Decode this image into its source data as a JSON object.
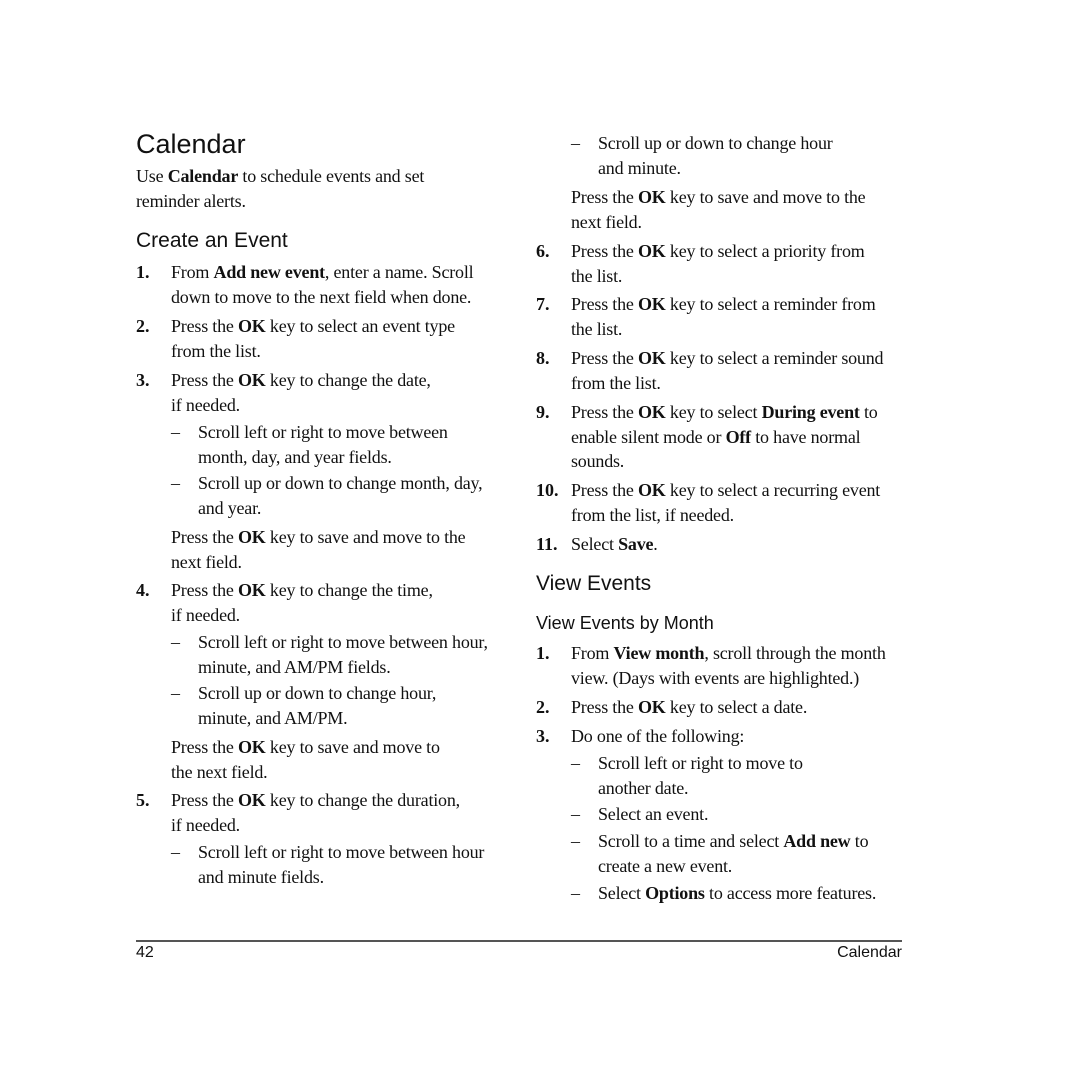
{
  "page": {
    "title": "Calendar",
    "intro_pre": "Use ",
    "intro_bold": "Calendar",
    "intro_post1": " to schedule events and set",
    "intro_post2": "reminder alerts."
  },
  "create_event": {
    "heading": "Create an Event",
    "steps": [
      {
        "num": "1.",
        "l1_pre": "From ",
        "l1_bold": "Add new event",
        "l1_post": ", enter a name. Scroll",
        "l2": "down to move to the next field when done."
      },
      {
        "num": "2.",
        "l1_pre": "Press the ",
        "l1_bold": "OK",
        "l1_post": " key to select an event type",
        "l2": "from the list."
      },
      {
        "num": "3.",
        "l1_pre": "Press the ",
        "l1_bold": "OK",
        "l1_post": " key to change the date,",
        "l2": "if needed.",
        "subs": [
          {
            "l1": "Scroll left or right to move between",
            "l2": "month, day, and year fields."
          },
          {
            "l1": "Scroll up or down to change month, day,",
            "l2": "and year."
          }
        ],
        "after_pre": "Press the ",
        "after_bold": "OK",
        "after_post": " key to save and move to the",
        "after_l2": "next field."
      },
      {
        "num": "4.",
        "l1_pre": "Press the ",
        "l1_bold": "OK",
        "l1_post": " key to change the time,",
        "l2": "if needed.",
        "subs": [
          {
            "l1": "Scroll left or right to move between hour,",
            "l2": "minute, and AM/PM fields."
          },
          {
            "l1": "Scroll up or down to change hour,",
            "l2": "minute, and AM/PM."
          }
        ],
        "after_pre": "Press the ",
        "after_bold": "OK",
        "after_post": " key to save and move to",
        "after_l2": "the next field."
      },
      {
        "num": "5.",
        "l1_pre": "Press the ",
        "l1_bold": "OK",
        "l1_post": " key to change the duration,",
        "l2": "if needed.",
        "subs": [
          {
            "l1": "Scroll left or right to move between hour",
            "l2": "and minute fields."
          },
          {
            "l1": "Scroll up or down to change hour",
            "l2": "and minute."
          }
        ],
        "after_pre": "Press the ",
        "after_bold": "OK",
        "after_post": " key to save and move to the",
        "after_l2": "next field."
      },
      {
        "num": "6.",
        "l1_pre": "Press the ",
        "l1_bold": "OK",
        "l1_post": " key to select a priority from",
        "l2": "the list."
      },
      {
        "num": "7.",
        "l1_pre": "Press the ",
        "l1_bold": "OK",
        "l1_post": " key to select a reminder from",
        "l2": "the list."
      },
      {
        "num": "8.",
        "l1_pre": "Press the ",
        "l1_bold": "OK",
        "l1_post": " key to select a reminder sound",
        "l2": "from the list."
      },
      {
        "num": "9.",
        "l1_pre": "Press the ",
        "l1_bold": "OK",
        "l1_mid": " key to select ",
        "l1_bold2": "During event",
        "l1_post": " to",
        "l2_pre": "enable silent mode or ",
        "l2_bold": "Off",
        "l2_post": " to have normal",
        "l3": "sounds."
      },
      {
        "num": "10.",
        "l1_pre": "Press the ",
        "l1_bold": "OK",
        "l1_post": " key to select a recurring event",
        "l2": "from the list, if needed."
      },
      {
        "num": "11.",
        "l1_pre": "Select ",
        "l1_bold": "Save",
        "l1_post": "."
      }
    ]
  },
  "view_events": {
    "heading": "View Events",
    "subheading": "View Events by Month",
    "steps": [
      {
        "num": "1.",
        "l1_pre": "From ",
        "l1_bold": "View month",
        "l1_post": ", scroll through the month",
        "l2": "view. (Days with events are highlighted.)"
      },
      {
        "num": "2.",
        "l1_pre": "Press the ",
        "l1_bold": "OK",
        "l1_post": " key to select a date."
      },
      {
        "num": "3.",
        "l1": "Do one of the following:",
        "subs": [
          {
            "l1": "Scroll left or right to move to",
            "l2": "another date."
          },
          {
            "l1": "Select an event."
          },
          {
            "l1_pre": "Scroll to a time and select ",
            "l1_bold": "Add new",
            "l1_post": " to",
            "l2": "create a new event."
          },
          {
            "l1_pre": "Select ",
            "l1_bold": "Options",
            "l1_post": " to access more features."
          }
        ]
      }
    ]
  },
  "footer": {
    "page_number": "42",
    "section": "Calendar"
  },
  "dash": "–"
}
